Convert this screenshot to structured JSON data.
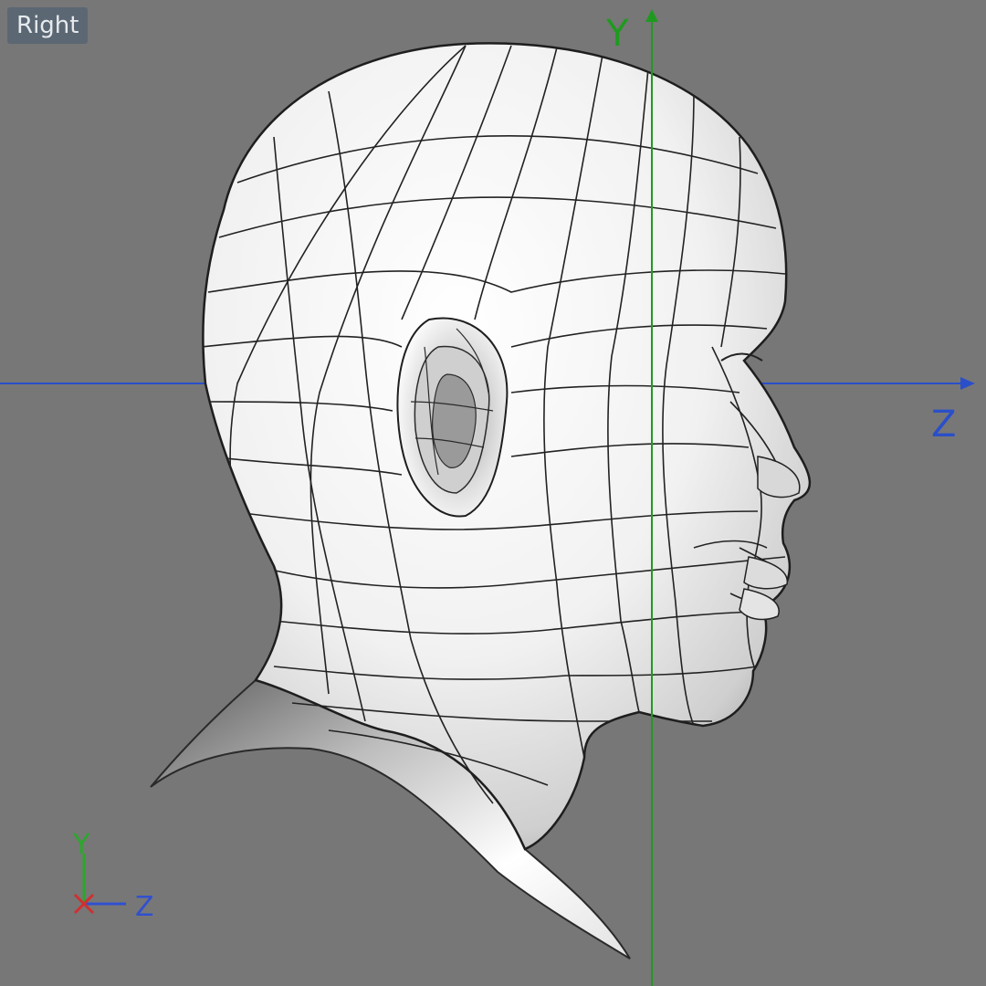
{
  "viewport": {
    "view_name": "Right",
    "background_color": "#777777"
  },
  "world_axes": {
    "y_label": "Y",
    "z_label": "Z",
    "y_color": "#1f9a1f",
    "z_color": "#2a4fc9"
  },
  "gizmo": {
    "y_label": "Y",
    "z_label": "Z",
    "x_color": "#d03030",
    "y_color": "#2aa82a",
    "z_color": "#3050d0"
  },
  "model": {
    "type": "head-wireframe-mesh",
    "shading": "white-smooth-with-wireframe"
  }
}
